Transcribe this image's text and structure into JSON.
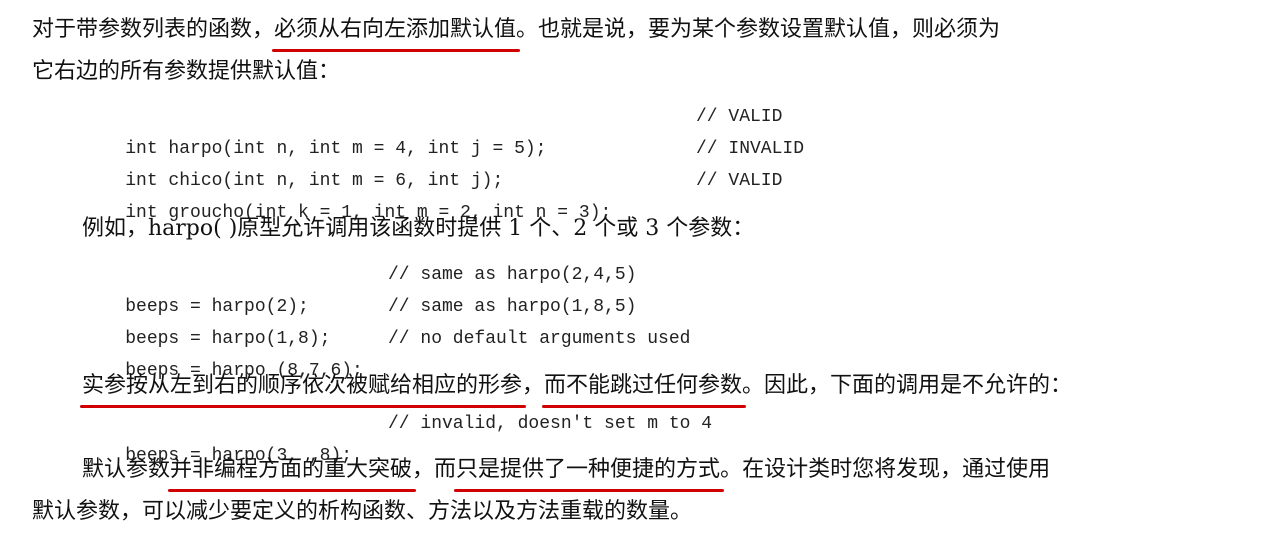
{
  "para1": {
    "line1_a": "对于带参数列表的函数，",
    "line1_hl": "必须从右向左添加默认值",
    "line1_b": "。也就是说，要为某个参数设置默认值，则必须为",
    "line2": "它右边的所有参数提供默认值："
  },
  "code1": [
    {
      "code": "int harpo(int n, int m = 4, int j = 5);",
      "comment": "// VALID"
    },
    {
      "code": "int chico(int n, int m = 6, int j);",
      "comment": "// INVALID"
    },
    {
      "code": "int groucho(int k = 1, int m = 2, int n = 3);",
      "comment": "// VALID"
    }
  ],
  "para2": "例如，harpo( )原型允许调用该函数时提供 1 个、2 个或 3 个参数：",
  "code2": [
    {
      "code": "beeps = harpo(2);",
      "comment": "// same as harpo(2,4,5)"
    },
    {
      "code": "beeps = harpo(1,8);",
      "comment": "// same as harpo(1,8,5)"
    },
    {
      "code": "beeps = harpo (8,7,6);",
      "comment": "// no default arguments used"
    }
  ],
  "para3": {
    "hl1": "实参按从左到右的顺序依次被赋给相应的形参",
    "sep": "，",
    "hl2": "而不能跳过任何参数",
    "rest": "。因此，下面的调用是不允许的："
  },
  "code3": {
    "code": "beeps = harpo(3, ,8);",
    "comment": "// invalid, doesn't set m to 4"
  },
  "para4": {
    "a": "默认参数",
    "hl1": "并非编程方面的重大突破",
    "b": "，而",
    "hl2": "只是提供了一种便捷的方式",
    "c": "。在设计类时您将发现，通过使用",
    "line2": "默认参数，可以减少要定义的析构函数、方法以及方法重载的数量。"
  },
  "colors": {
    "underline": "#d00000",
    "text": "#111111"
  }
}
